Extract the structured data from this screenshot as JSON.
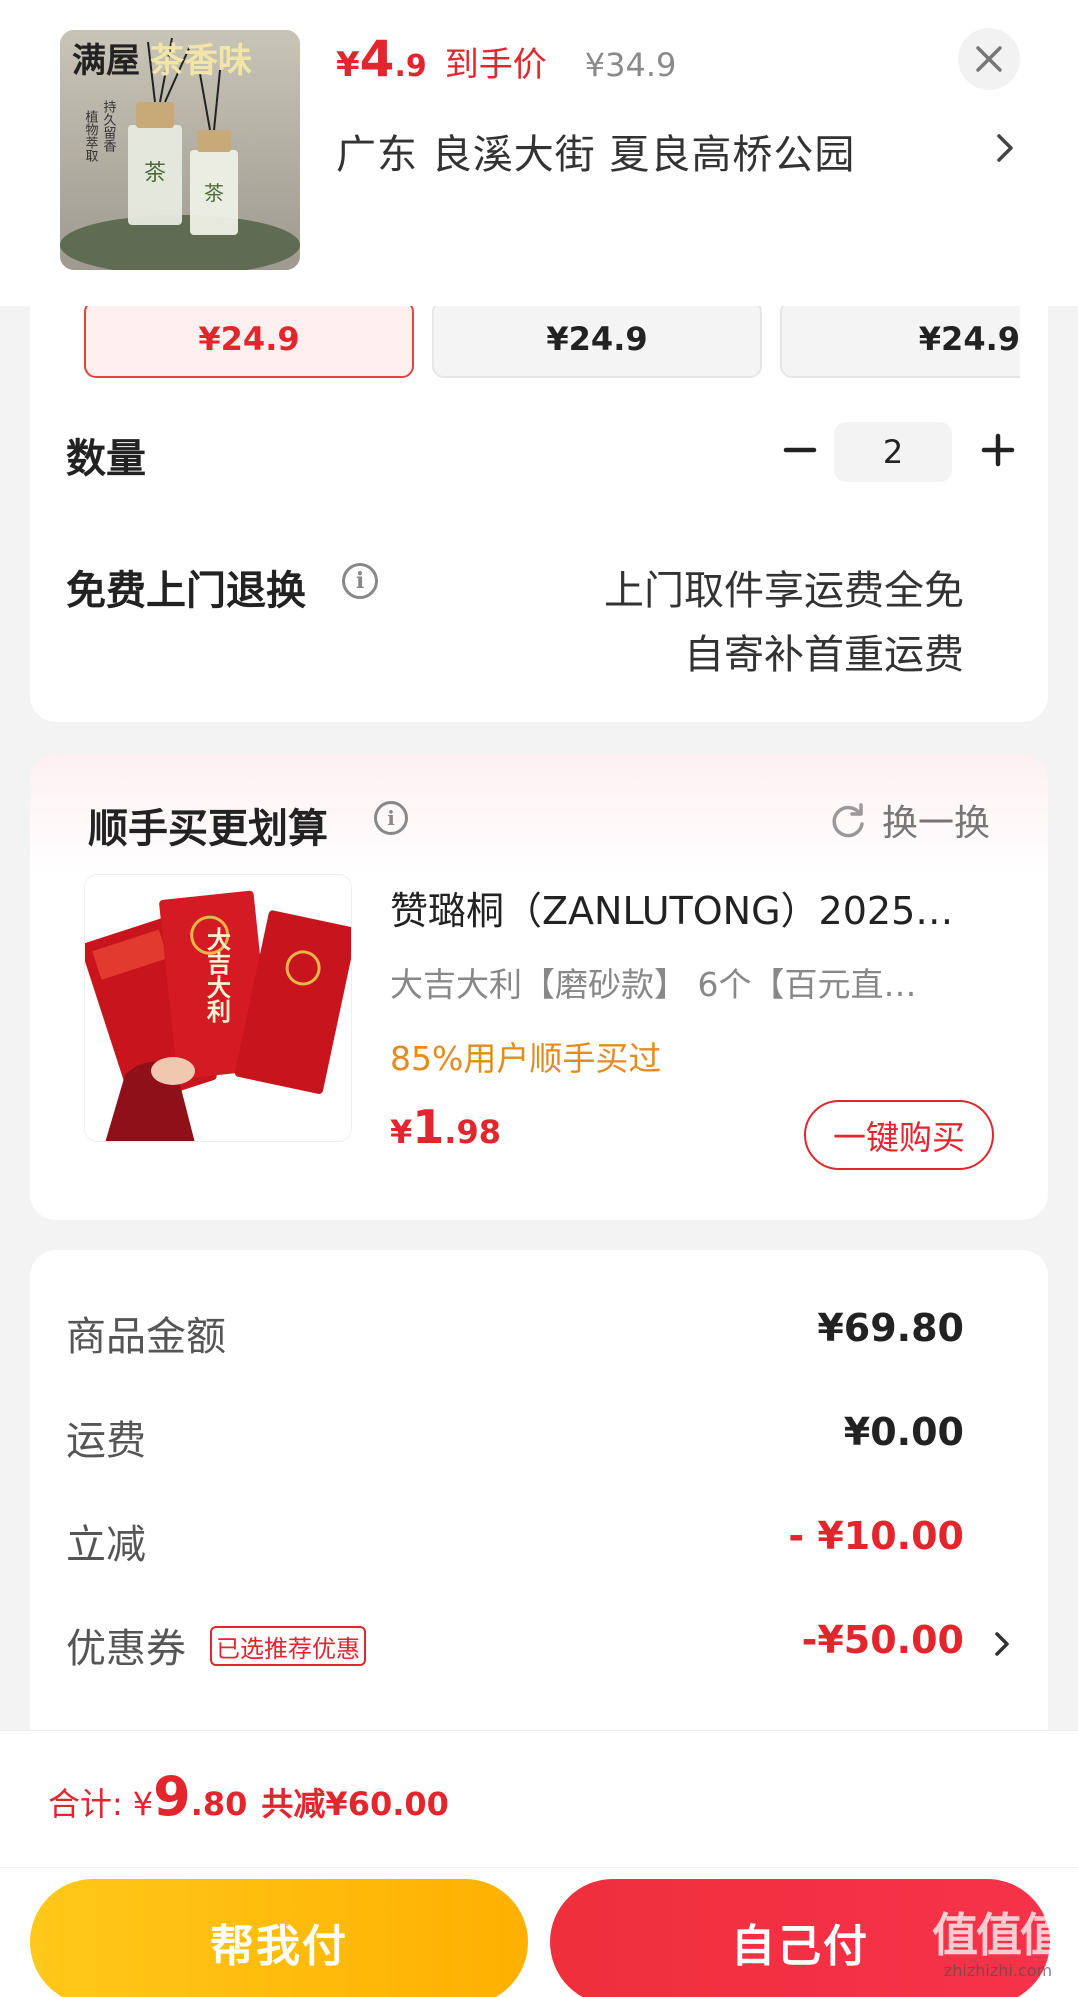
{
  "header": {
    "thumb_text_top": "满屋",
    "thumb_text_highlight": "茶香味",
    "thumb_side_left": "植物萃取",
    "thumb_side_right": "持久留香",
    "thumb_bottle_label": "茶",
    "price_symbol": "¥",
    "price_int": "4",
    "price_dec": ".9",
    "price_tag": "到手价",
    "original_price": "¥34.9",
    "address": "广东  良溪大街 夏良高桥公园"
  },
  "specs": [
    {
      "price": "¥24.9",
      "selected": true
    },
    {
      "price": "¥24.9",
      "selected": false
    },
    {
      "price": "¥24.9",
      "selected": false
    }
  ],
  "quantity": {
    "label": "数量",
    "value": "2"
  },
  "return_service": {
    "label": "免费上门退换",
    "line1": "上门取件享运费全免",
    "line2": "自寄补首重运费"
  },
  "recommend": {
    "title": "顺手买更划算",
    "swap_label": "换一换",
    "product_name": "赞璐桐（ZANLUTONG）2025…",
    "product_spec": "大吉大利【磨砂款】  6个【百元直…",
    "social_proof": "85%用户顺手买过",
    "price_symbol": "¥",
    "price_int": "1",
    "price_dec": ".98",
    "buy_label": "一键购买",
    "image_text": "大吉大利"
  },
  "summary": {
    "goods_label": "商品金额",
    "goods_value": "¥69.80",
    "shipping_label": "运费",
    "shipping_value": "¥0.00",
    "discount_label": "立减",
    "discount_value": "- ¥10.00",
    "coupon_label": "优惠券",
    "coupon_badge": "已选推荐优惠",
    "coupon_value": "-¥50.00"
  },
  "footer": {
    "total_label": "合计:",
    "total_symbol": "¥",
    "total_int": "9",
    "total_dec": ".80",
    "total_saved": "共减¥60.00",
    "help_pay_label": "帮我付",
    "self_pay_label": "自己付",
    "watermark_main": "值值值",
    "watermark_sub": "zhizhizhi.com"
  },
  "colors": {
    "accent_red": "#e3262d",
    "accent_orange": "#e68a1f",
    "help_button": "#ffbc00",
    "self_button": "#f2303f"
  },
  "icons": [
    "close-icon",
    "chevron-right-icon",
    "minus-icon",
    "plus-icon",
    "info-icon",
    "refresh-icon"
  ]
}
